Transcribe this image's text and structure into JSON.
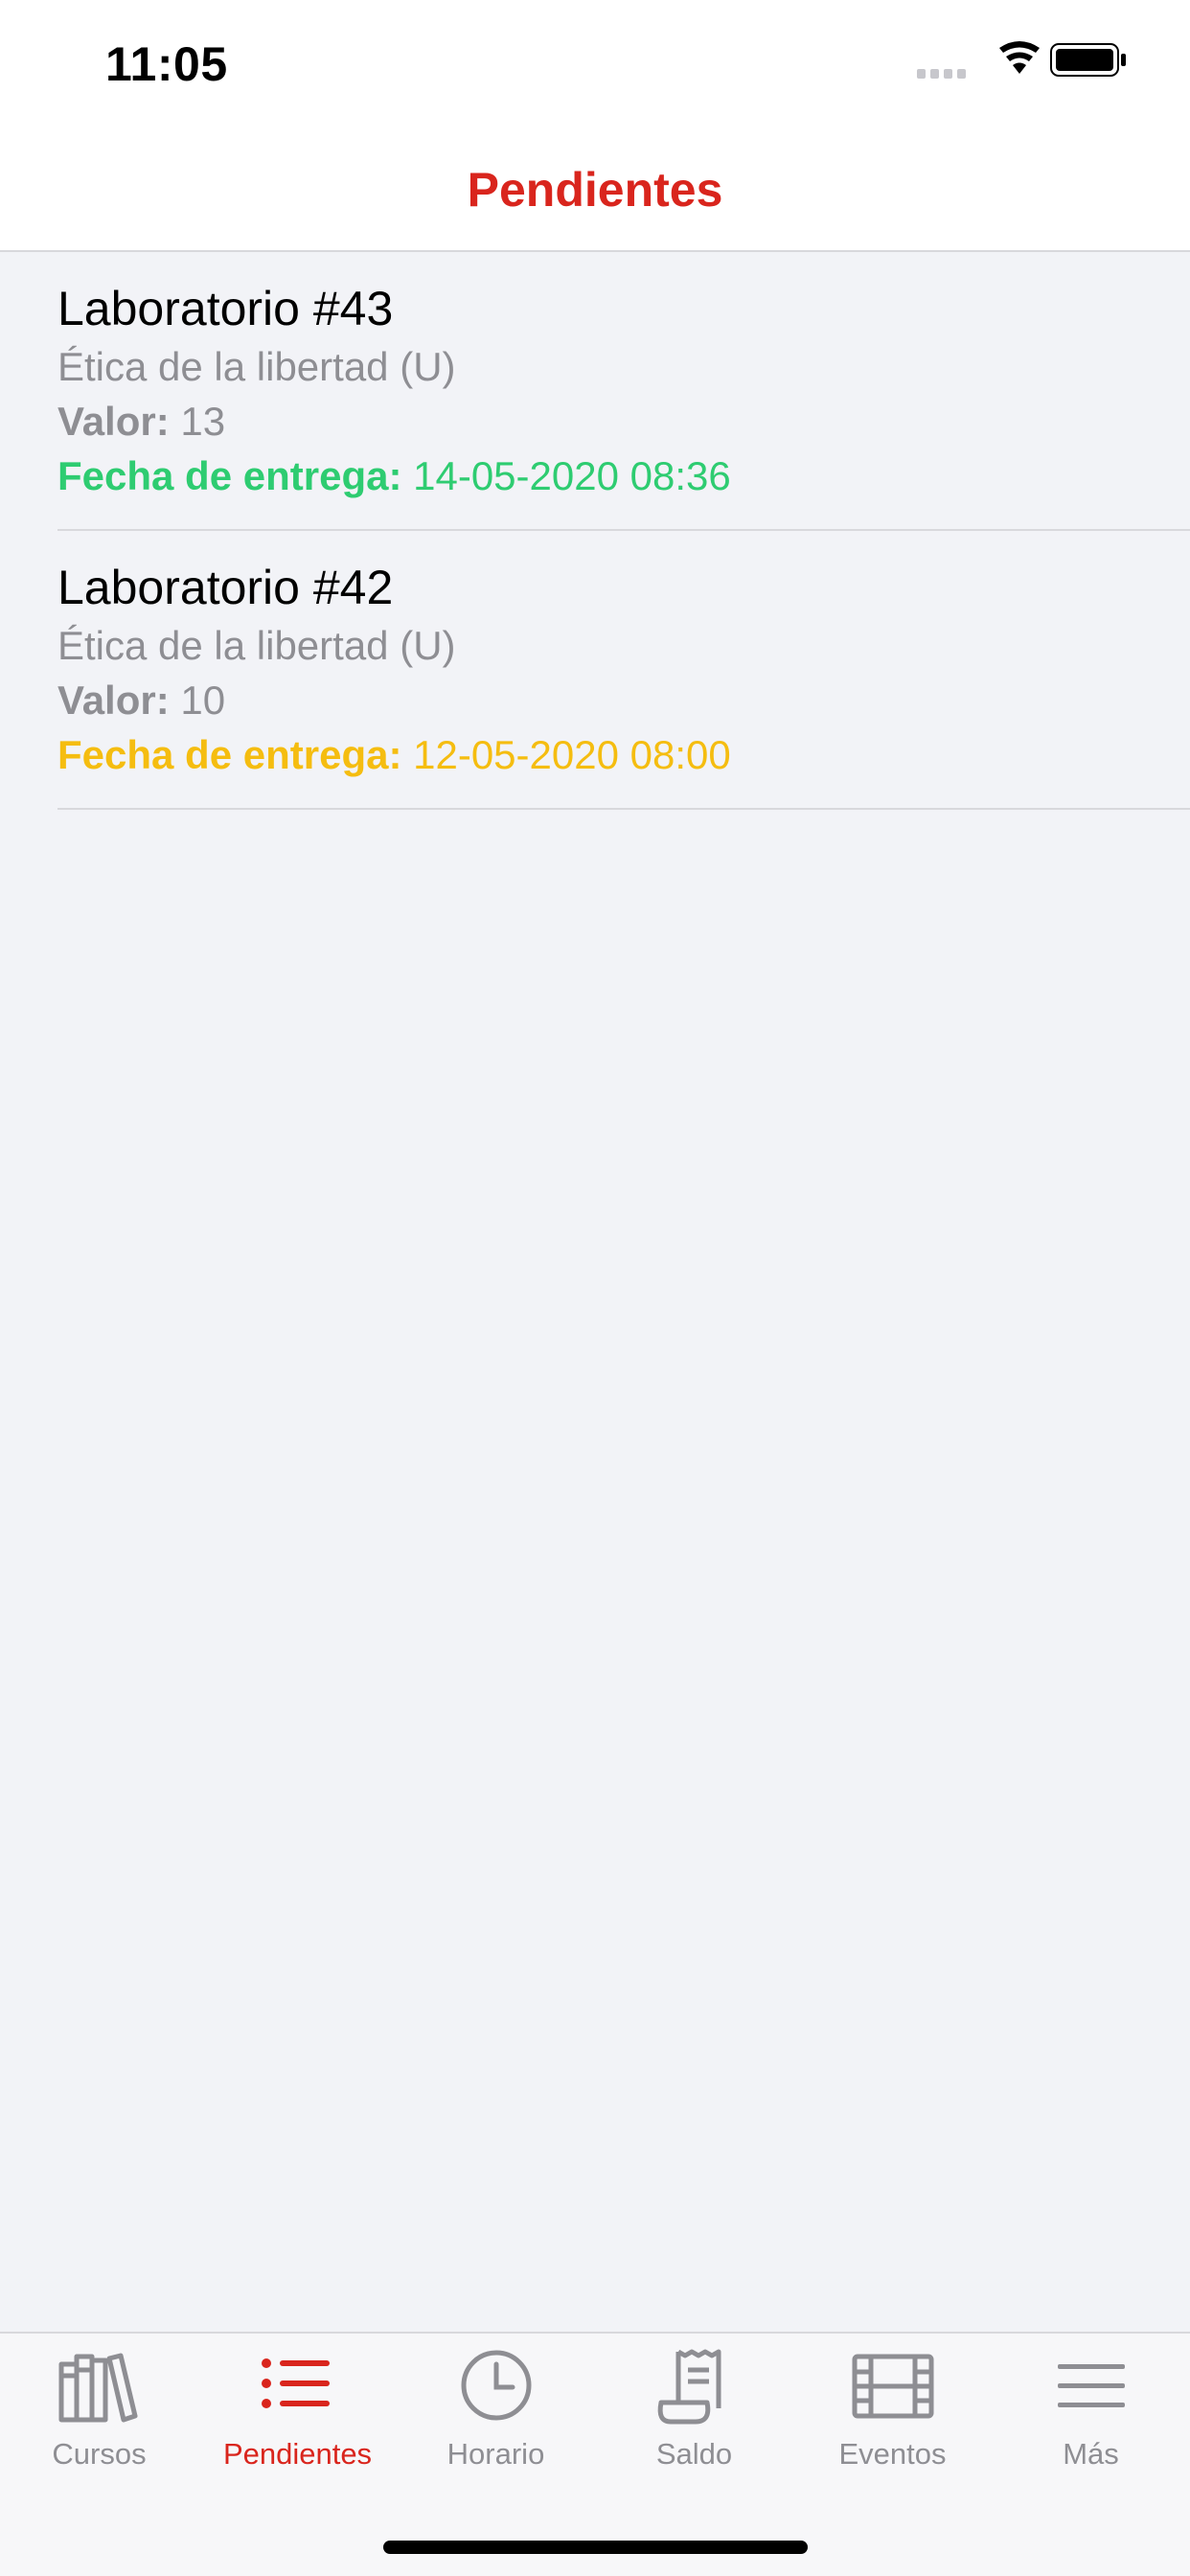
{
  "status_bar": {
    "time": "11:05"
  },
  "nav": {
    "title": "Pendientes"
  },
  "colors": {
    "accent": "#d9251d",
    "green": "#2ecc71",
    "yellow": "#f5bd10",
    "gray": "#8e8e93"
  },
  "items": [
    {
      "title": "Laboratorio #43",
      "subject": "Ética de la libertad (U)",
      "value_label": "Valor:",
      "value": "13",
      "due_label": "Fecha de entrega:",
      "due": "14-05-2020 08:36",
      "due_color": "green"
    },
    {
      "title": "Laboratorio #42",
      "subject": "Ética de la libertad (U)",
      "value_label": "Valor:",
      "value": "10",
      "due_label": "Fecha de entrega:",
      "due": "12-05-2020 08:00",
      "due_color": "yellow"
    }
  ],
  "tabs": [
    {
      "label": "Cursos",
      "icon": "books-icon"
    },
    {
      "label": "Pendientes",
      "icon": "list-icon",
      "active": true
    },
    {
      "label": "Horario",
      "icon": "clock-icon"
    },
    {
      "label": "Saldo",
      "icon": "receipt-icon"
    },
    {
      "label": "Eventos",
      "icon": "film-icon"
    },
    {
      "label": "Más",
      "icon": "menu-icon"
    }
  ]
}
